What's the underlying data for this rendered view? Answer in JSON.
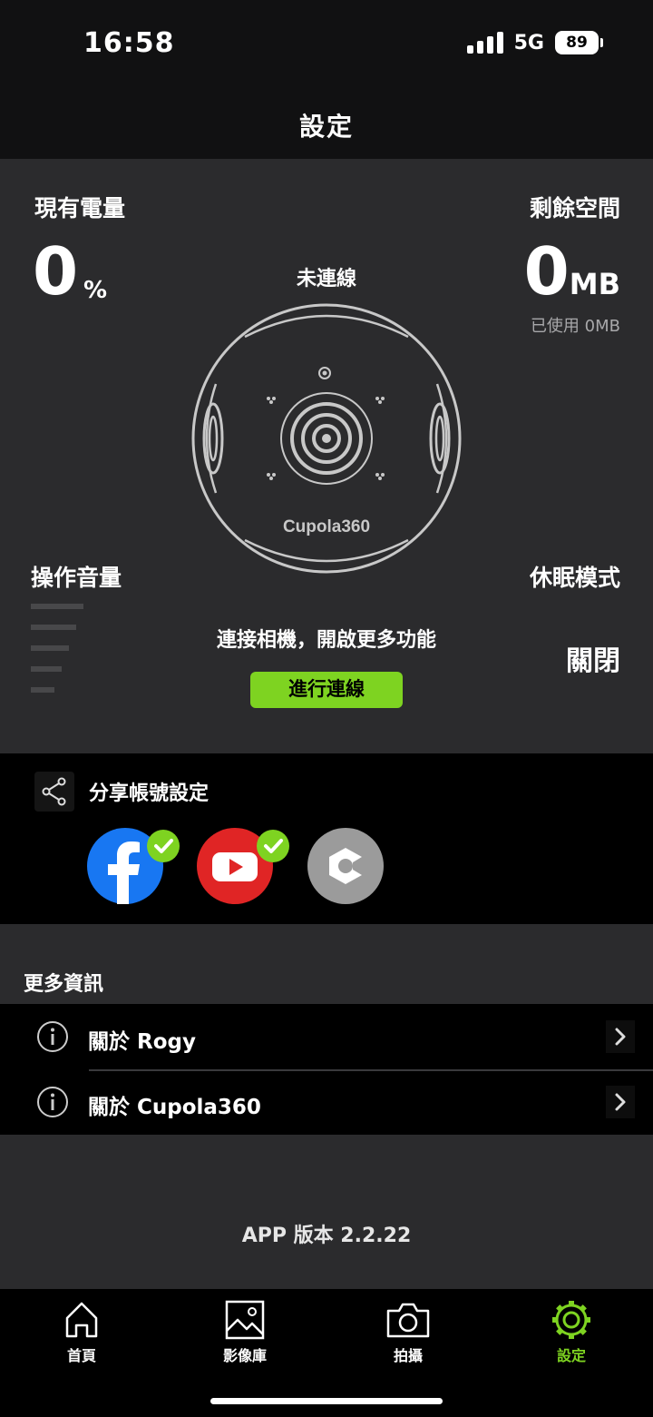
{
  "status_bar": {
    "time": "16:58",
    "network": "5G",
    "battery": "89"
  },
  "nav": {
    "title": "設定"
  },
  "dashboard": {
    "battery_label": "現有電量",
    "battery_value": "0",
    "battery_unit": "%",
    "storage_label": "剩餘空間",
    "storage_value": "0",
    "storage_unit": "MB",
    "storage_used": "已使用 0MB",
    "connection_status": "未連線",
    "camera_brand": "Cupola360",
    "volume_label": "操作音量",
    "volume_level": 0,
    "sleep_label": "休眠模式",
    "sleep_value": "關閉",
    "connect_prompt": "連接相機，開啟更多功能",
    "connect_button": "進行連線"
  },
  "share": {
    "title": "分享帳號設定",
    "accounts": [
      {
        "icon": "facebook-icon",
        "linked": true
      },
      {
        "icon": "youtube-icon",
        "linked": true
      },
      {
        "icon": "account-service-icon",
        "linked": false
      }
    ]
  },
  "more_info": {
    "title": "更多資訊",
    "items": [
      {
        "label": "關於 Rogy",
        "icon": "info-icon"
      },
      {
        "label": "關於 Cupola360",
        "icon": "info-icon"
      }
    ],
    "app_version": "APP 版本 2.2.22"
  },
  "tabs": [
    {
      "label": "首頁",
      "icon": "home-icon",
      "active": false
    },
    {
      "label": "影像庫",
      "icon": "gallery-icon",
      "active": false
    },
    {
      "label": "拍攝",
      "icon": "camera-icon",
      "active": false
    },
    {
      "label": "設定",
      "icon": "gear-icon",
      "active": true
    }
  ],
  "colors": {
    "accent": "#7ed321",
    "panel": "#2b2b2d",
    "facebook": "#1877f2",
    "youtube": "#e02525"
  }
}
